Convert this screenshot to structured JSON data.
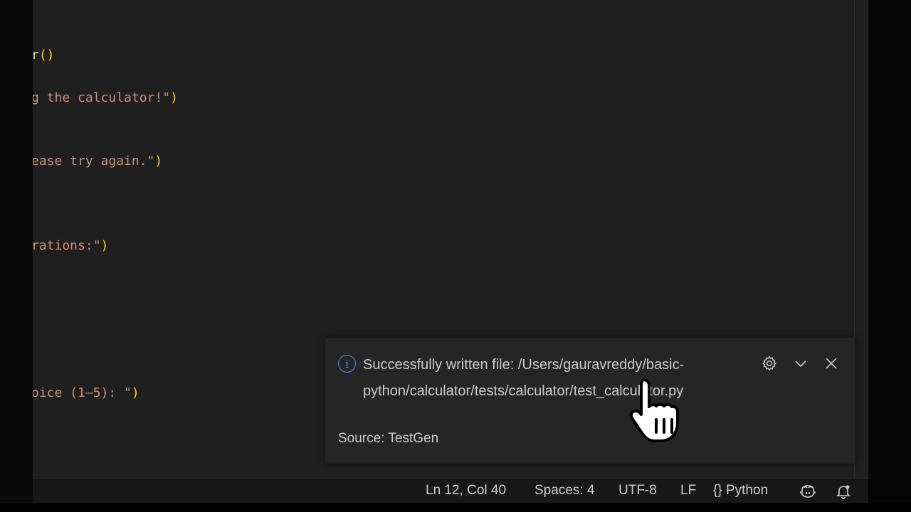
{
  "editor": {
    "lines": [
      {
        "pre": "r",
        "paren": "()",
        "str": "",
        "tail": ""
      },
      {
        "pre": "",
        "paren": "",
        "str": "g the calculator!\"",
        "tail": ")"
      },
      {
        "pre": "",
        "paren": "",
        "str": "ease try again.\"",
        "tail": ")"
      },
      {
        "pre": "",
        "paren": "",
        "str": "rations:\"",
        "tail": ")"
      },
      {
        "pre": "",
        "paren": "",
        "str": "oice (1–5): \"",
        "tail": ")"
      }
    ]
  },
  "notification": {
    "message_line1": "Successfully written file: /Users/gauravreddy/basic-",
    "message_line2": "python/calculator/tests/calculator/test_calculator.py",
    "source": "Source: TestGen",
    "icons": {
      "info": "info-icon",
      "settings": "gear-icon",
      "collapse": "chevron-down-icon",
      "close": "close-icon"
    },
    "info_glyph": "i"
  },
  "statusbar": {
    "position": "Ln 12, Col 40",
    "indent": "Spaces: 4",
    "encoding": "UTF-8",
    "eol": "LF",
    "language_braces": "{}",
    "language": "Python",
    "icons": {
      "copilot": "copilot-icon",
      "notifications": "bell-icon"
    }
  },
  "colors": {
    "editor_bg": "#1f1f1f",
    "string": "#ce9178",
    "bracket": "#ffd700",
    "info_blue": "#3794ff",
    "toast_bg": "#252526",
    "statusbar_bg": "#181818"
  }
}
